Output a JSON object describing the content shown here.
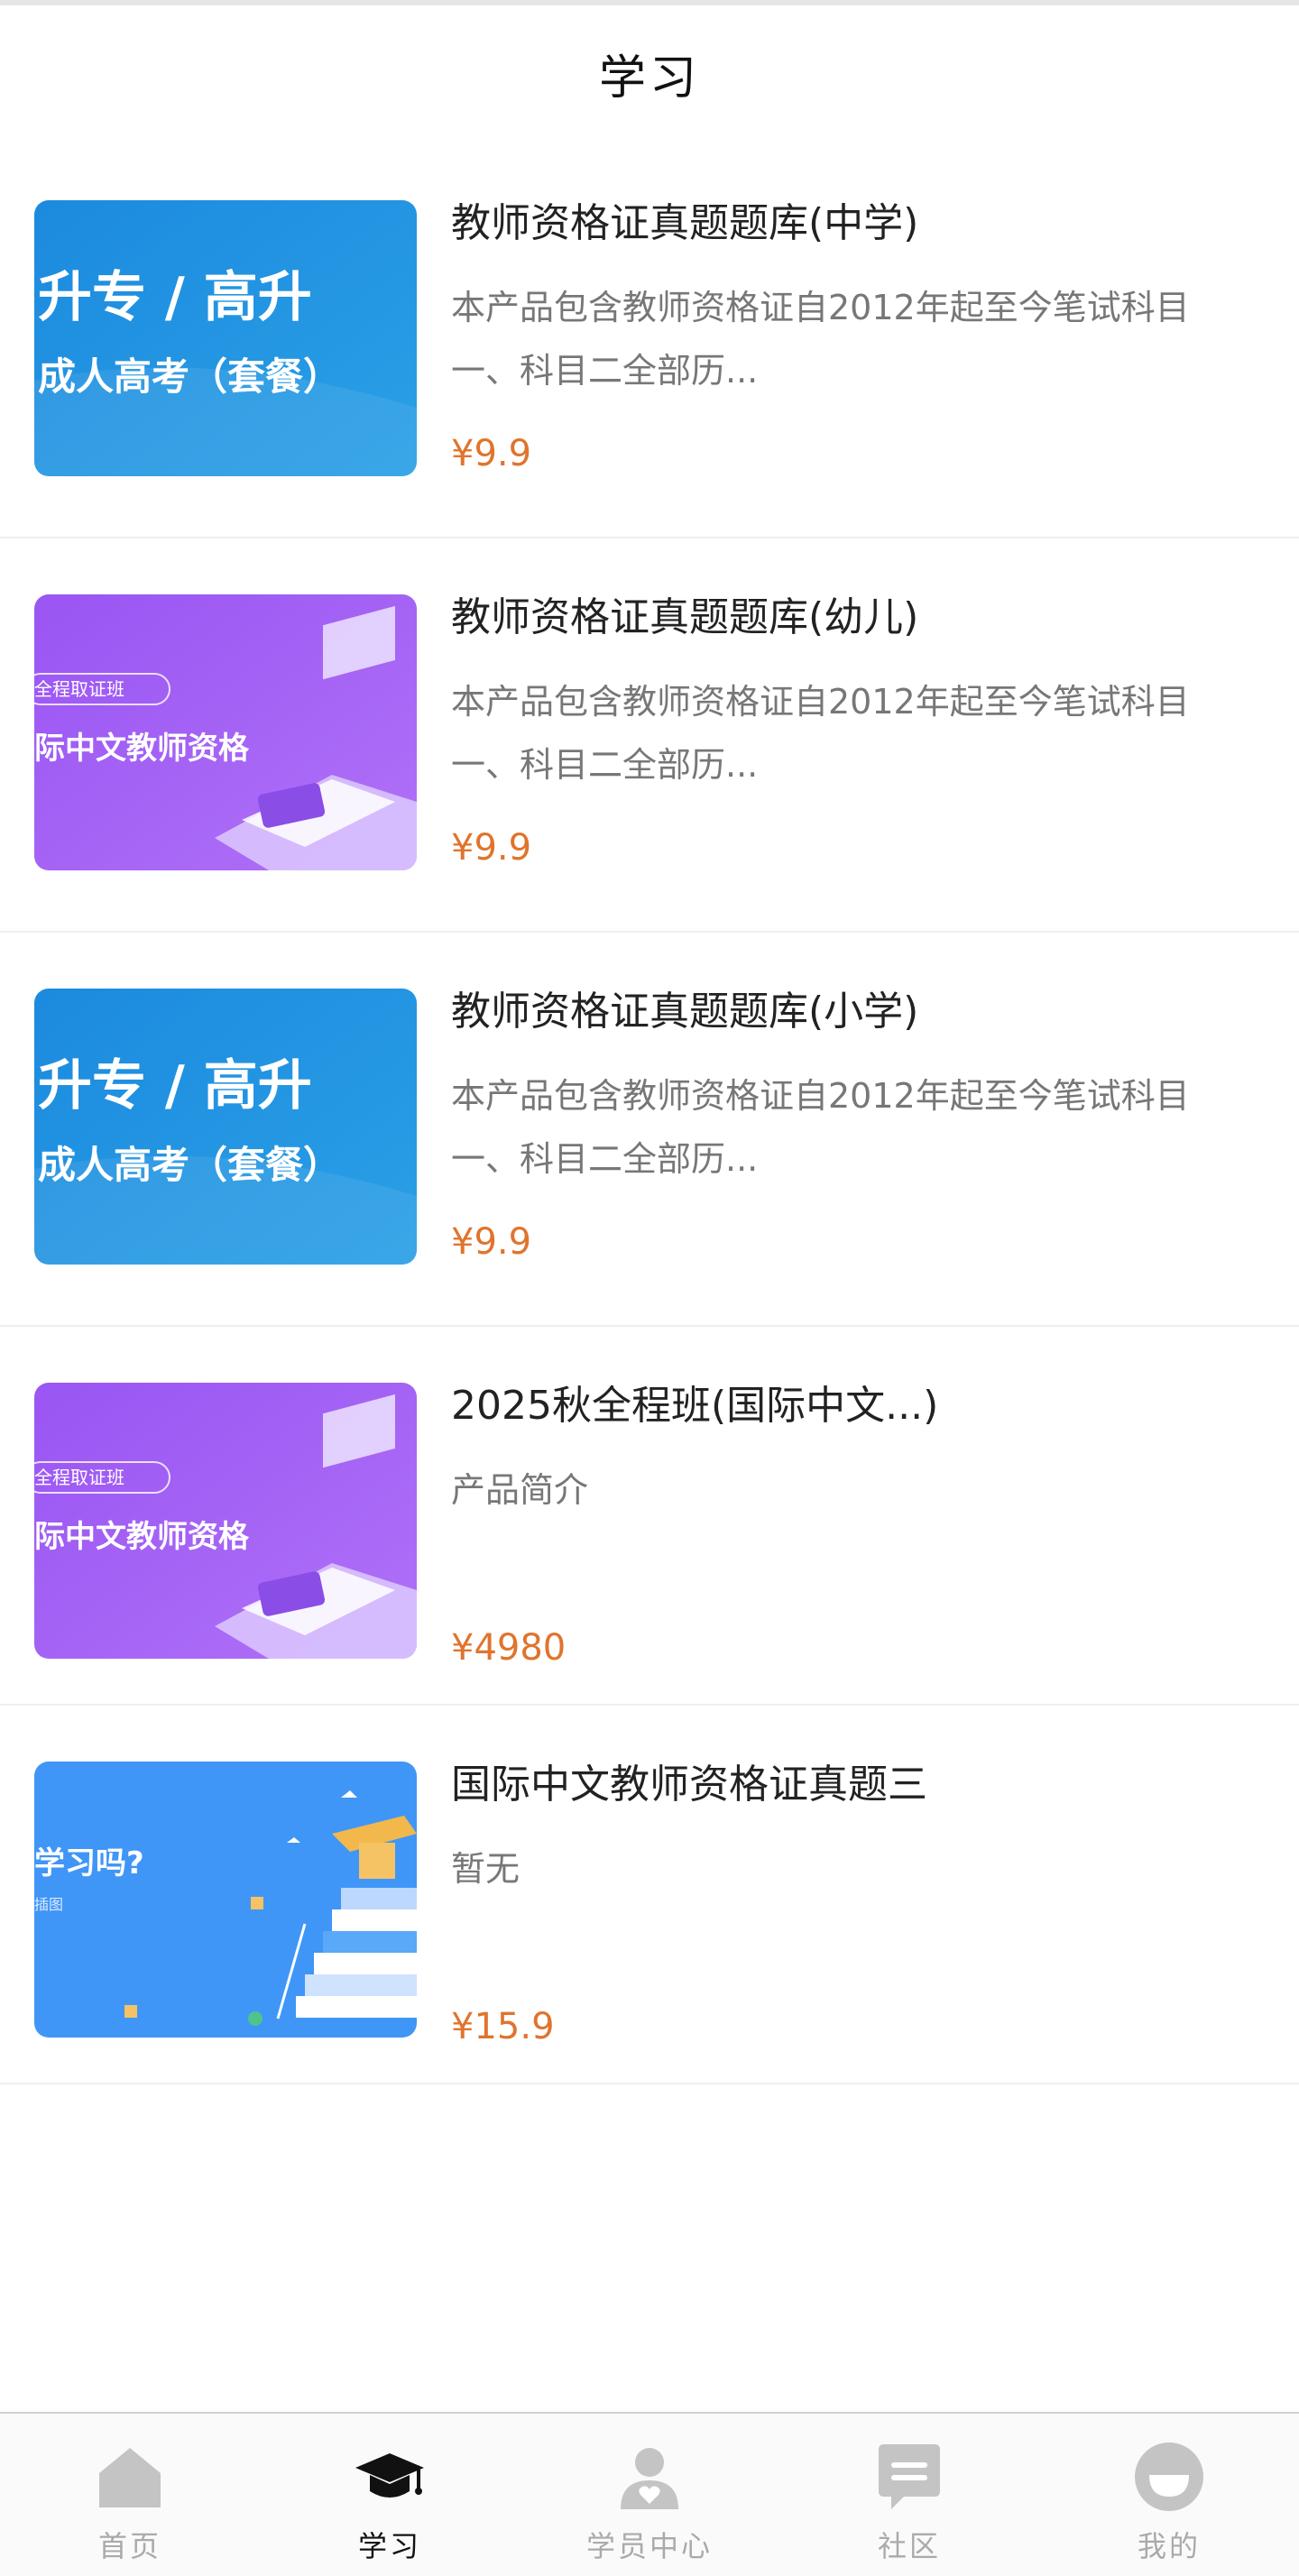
{
  "header": {
    "title": "学习"
  },
  "items": [
    {
      "title": "教师资格证真题题库(中学)",
      "desc": "本产品包含教师资格证自2012年起至今笔试科目一、科目二全部历...",
      "price": "¥9.9",
      "thumb": {
        "type": "blue-banner",
        "line1": "升专 / 高升",
        "line2": "成人高考（套餐）"
      }
    },
    {
      "title": "教师资格证真题题库(幼儿)",
      "desc": "本产品包含教师资格证自2012年起至今笔试科目一、科目二全部历...",
      "price": "¥9.9",
      "thumb": {
        "type": "purple-banner",
        "tag": "全程取证班",
        "line": "际中文教师资格"
      }
    },
    {
      "title": "教师资格证真题题库(小学)",
      "desc": "本产品包含教师资格证自2012年起至今笔试科目一、科目二全部历...",
      "price": "¥9.9",
      "thumb": {
        "type": "blue-banner",
        "line1": "升专 / 高升",
        "line2": "成人高考（套餐）"
      }
    },
    {
      "title": "2025秋全程班(国际中文...)",
      "desc": "产品简介",
      "price": "¥4980",
      "thumb": {
        "type": "purple-banner",
        "tag": "全程取证班",
        "line": "际中文教师资格"
      }
    },
    {
      "title": "国际中文教师资格证真题三",
      "desc": "暂无",
      "price": "¥15.9",
      "thumb": {
        "type": "books-banner",
        "line": "学习吗?",
        "sub": "插图"
      }
    }
  ],
  "tabbar": {
    "tabs": [
      {
        "label": "首页",
        "icon": "home-icon"
      },
      {
        "label": "学习",
        "icon": "graduation-cap-icon",
        "active": true
      },
      {
        "label": "学员中心",
        "icon": "user-heart-icon"
      },
      {
        "label": "社区",
        "icon": "chat-icon"
      },
      {
        "label": "我的",
        "icon": "profile-circle-icon"
      }
    ]
  },
  "colors": {
    "price": "#e0742d",
    "inactive_tab": "#aaaaaa",
    "active_tab": "#111111",
    "blue_banner": "#1e8fe0",
    "purple_banner": "#a35ef5",
    "books_banner": "#3f96f7"
  }
}
